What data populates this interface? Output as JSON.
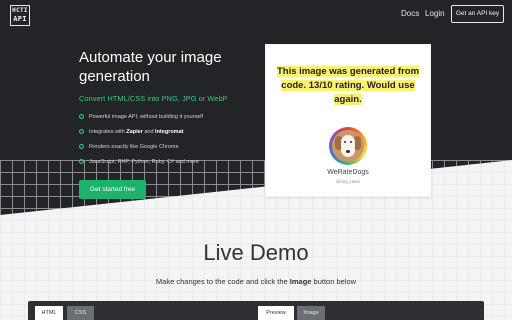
{
  "header": {
    "logo": {
      "line1": "HCTI",
      "line2": "API"
    },
    "nav": [
      {
        "label": "Docs"
      },
      {
        "label": "Login"
      }
    ],
    "cta_label": "Get an API key"
  },
  "hero": {
    "title": "Automate your image generation",
    "subtitle": "Convert HTML/CSS into PNG, JPG or WebP",
    "features": [
      {
        "pre": "Powerful image API, without building it yourself",
        "bold1": "",
        "mid": "",
        "bold2": ""
      },
      {
        "pre": "Integrates with ",
        "bold1": "Zapier",
        "mid": " and ",
        "bold2": "Integromat"
      },
      {
        "pre": "Renders exactly like Google Chrome",
        "bold1": "",
        "mid": "",
        "bold2": ""
      },
      {
        "pre": "JavaScript, PHP, Python, Ruby, C# and more",
        "bold1": "",
        "mid": "",
        "bold2": ""
      }
    ],
    "cta_label": "Get started free"
  },
  "sample_card": {
    "text": "This image was generated from code. 13/10 rating. Would use again.",
    "name": "WeRateDogs",
    "handle": "@dog_rates"
  },
  "live_demo": {
    "title": "Live Demo",
    "instruction_pre": "Make changes to the code and click the ",
    "instruction_bold": "Image",
    "instruction_post": " button below",
    "code_tabs": [
      {
        "label": "HTML",
        "active": true
      },
      {
        "label": "CSS",
        "active": false
      }
    ],
    "view_tabs": [
      {
        "label": "Preview",
        "active": true
      },
      {
        "label": "Image",
        "active": false
      }
    ]
  },
  "colors": {
    "hero_bg": "#222427",
    "accent_green": "#1bb36a",
    "highlight_yellow": "#fbf06f",
    "page_bg": "#f3f4f6"
  }
}
